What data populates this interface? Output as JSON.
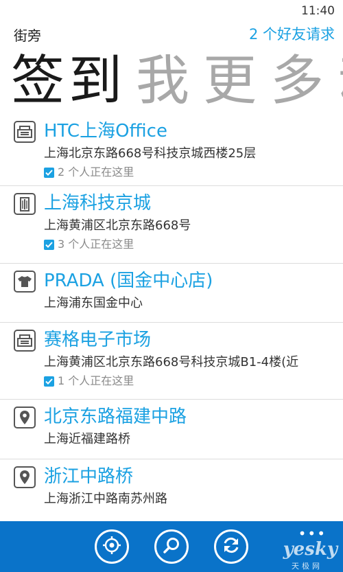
{
  "status_bar": {
    "time": "11:40"
  },
  "header": {
    "title": "街旁",
    "friend_requests": "2 个好友请求"
  },
  "pivot": {
    "tabs": [
      {
        "label": "签到",
        "active": true
      },
      {
        "label": "我",
        "active": false
      },
      {
        "label": "更",
        "active": false
      },
      {
        "label": "多",
        "active": false
      },
      {
        "label": "动",
        "active": false
      }
    ]
  },
  "places": [
    {
      "icon": "cash-register-icon",
      "name": "HTC上海Office",
      "address": "上海北京东路668号科技京城西楼25层",
      "here": "2 个人正在这里"
    },
    {
      "icon": "building-icon",
      "name": "上海科技京城",
      "address": "上海黄浦区北京东路668号",
      "here": "3 个人正在这里"
    },
    {
      "icon": "shirt-icon",
      "name": "PRADA (国金中心店)",
      "address": "上海浦东国金中心",
      "here": ""
    },
    {
      "icon": "cash-register-icon",
      "name": "赛格电子市场",
      "address": "上海黄浦区北京东路668号科技京城B1-4楼(近",
      "here": "1 个人正在这里"
    },
    {
      "icon": "map-pin-icon",
      "name": "北京东路福建中路",
      "address": "上海近福建路桥",
      "here": ""
    },
    {
      "icon": "map-pin-icon",
      "name": "浙江中路桥",
      "address": "上海浙江中路南苏州路",
      "here": ""
    }
  ],
  "app_bar": {
    "buttons": [
      "locate-icon",
      "search-icon",
      "refresh-icon"
    ],
    "more": "•••"
  },
  "watermark": {
    "brand": "yesky",
    "sub": "天极网"
  },
  "colors": {
    "accent": "#1ba1e2",
    "app_bar": "#0a73c9"
  }
}
